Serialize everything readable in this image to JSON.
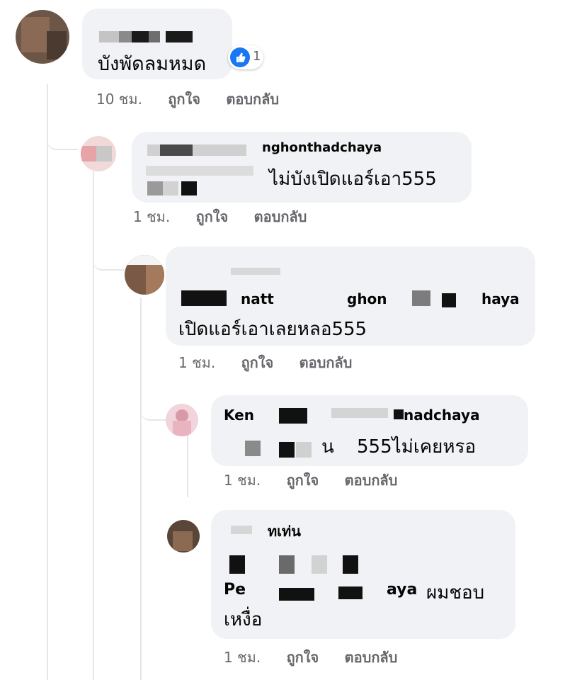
{
  "comments": [
    {
      "text_lines": [
        "บังพัดลมหมด"
      ],
      "reaction": {
        "icon": "thumbs-up-icon",
        "count": "1"
      },
      "time": "10 ชม.",
      "like_label": "ถูกใจ",
      "reply_label": "ตอบกลับ"
    },
    {
      "name": "nghonthadchaya",
      "text_lines": [
        "ไม่บังเปิดแอร์เอา555"
      ],
      "time": "1 ชม.",
      "like_label": "ถูกใจ",
      "reply_label": "ตอบกลับ"
    },
    {
      "name_fragment_1": "natt",
      "name_fragment_2": "ghon",
      "name_fragment_3": "haya",
      "text_lines": [
        "เปิดแอร์เอาเลยหลอ555"
      ],
      "time": "1 ชม.",
      "like_label": "ถูกใจ",
      "reply_label": "ตอบกลับ"
    },
    {
      "name": "Ken",
      "name_tail": "nadchaya",
      "text_prefix": "น",
      "text_lines": [
        "555ไม่เคยหรอ"
      ],
      "time": "1 ชม.",
      "like_label": "ถูกใจ",
      "reply_label": "ตอบกลับ"
    },
    {
      "name": "ทเท่น",
      "mention_start": "Pe",
      "mention_end": "aya",
      "text_lines": [
        "ผมชอบ",
        "เหงื่อ"
      ],
      "time": "1 ชม.",
      "like_label": "ถูกใจ",
      "reply_label": "ตอบกลับ"
    }
  ],
  "colors": {
    "bubble": "#f0f2f5",
    "meta_text": "#65676b",
    "like_blue": "#1877f2",
    "thread_line": "#e4e6eb"
  }
}
